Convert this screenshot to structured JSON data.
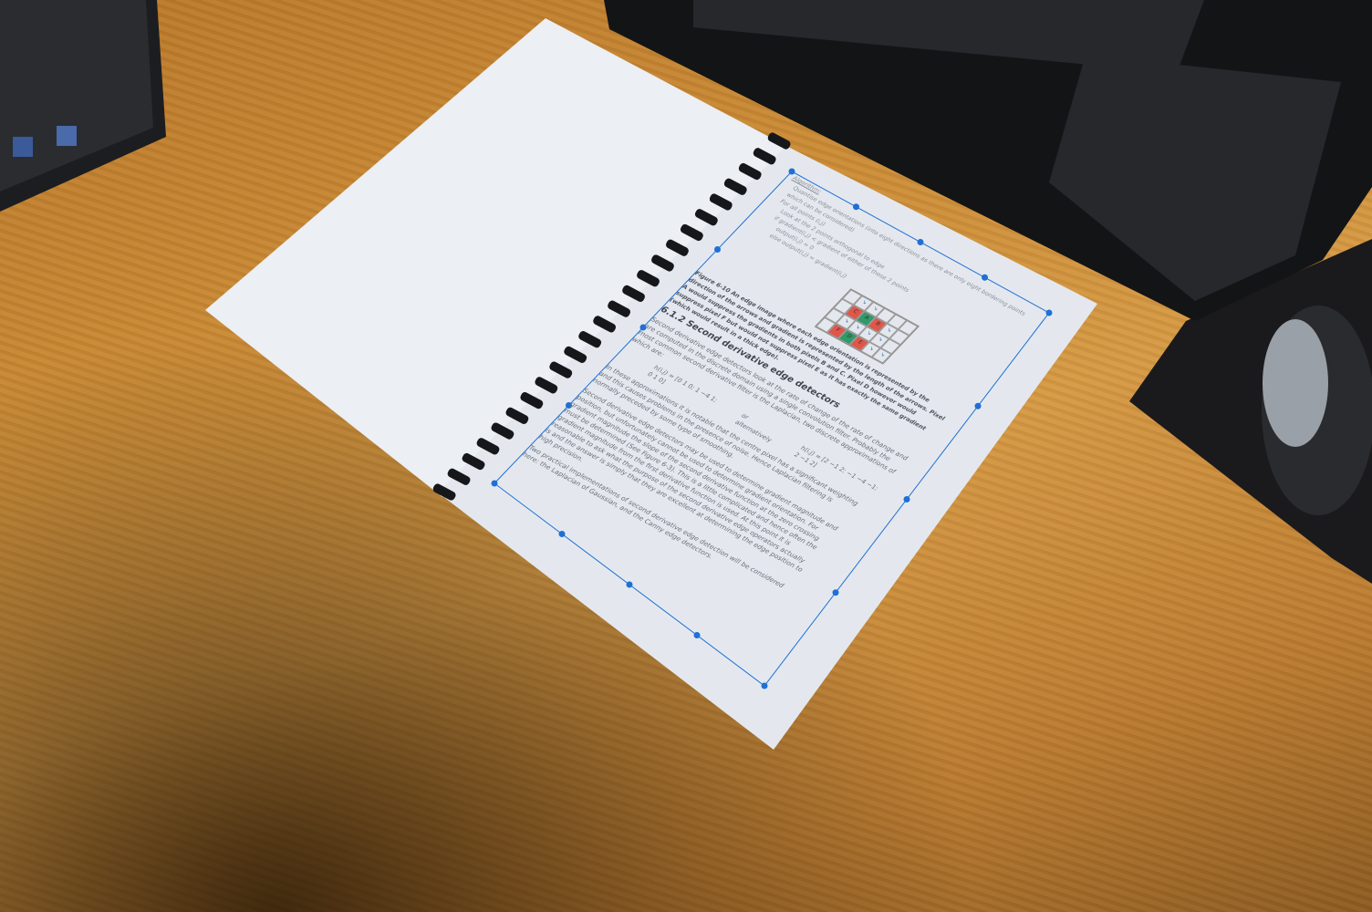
{
  "document": {
    "algorithm_label": "Algorithm:",
    "algorithm_lines": [
      "Quantise edge orientations (into eight directions as there are only eight bordering points which can be considered)",
      "For all points (i,j)",
      "Look at the 2 points orthogonal to edge",
      "if gradient(i,j) < gradient of either of these 2 points",
      "output(i,j) = 0",
      "else output(i,j) = gradient(i,j)"
    ],
    "figure_caption": "Figure 6-10 An edge image where each edge orientation is represented by the direction of the arrows and gradient is represented by the length of the arrows. Pixel A would suppress the gradients in both pixels B and C. Pixel D however would suppress pixel F but would not suppress pixel E as it has exactly the same gradient (which would result in a thick edge).",
    "figure_labels": [
      "C",
      "A",
      "B",
      "F",
      "D",
      "E"
    ],
    "section_title": "6.1.2   Second derivative edge detectors",
    "paragraph1": "Second derivative edge detectors look at the rate of change of the rate of change and are computed in the discrete domain using a single convolution filter. Probably the most common second derivative filter is the Laplacian, two discrete approximations of which are:",
    "matrix1": "h(i,j) = [0 1 0; 1 −4 1; 0 1 0]",
    "or_text": "or alternatively",
    "matrix2": "h(i,j) = [2 −1 2; −1 −4 −1; 2 −1 2]",
    "paragraph2": "In these approximations it is notable that the centre pixel has a significant weighting and this causes problems in the presence of noise. Hence Laplacian filtering is normally preceded by some type of smoothing.",
    "paragraph3": "Second derivative edge detectors may be used to determine gradient magnitude and position, but unfortunately cannot be used to determine gradient orientation. For gradient magnitude the slope of the second derivative function at the zero crossing must be determined (See Figure 6-3). This is a little complicated and hence often the gradient magnitude from the first derivative function is used. At this point it is reasonable to ask what the purpose of the second derivative edge operators actually is and the answer is simply that they are excellent at determining the edge position to high precision.",
    "paragraph4": "Two practical implementations of second derivative edge detection will be considered here: the Laplacian of Gaussian, and the Canny edge detectors."
  },
  "colors": {
    "selection": "#1f6fd6",
    "red_cell": "#e0574a",
    "green_cell": "#2f9a6a"
  }
}
